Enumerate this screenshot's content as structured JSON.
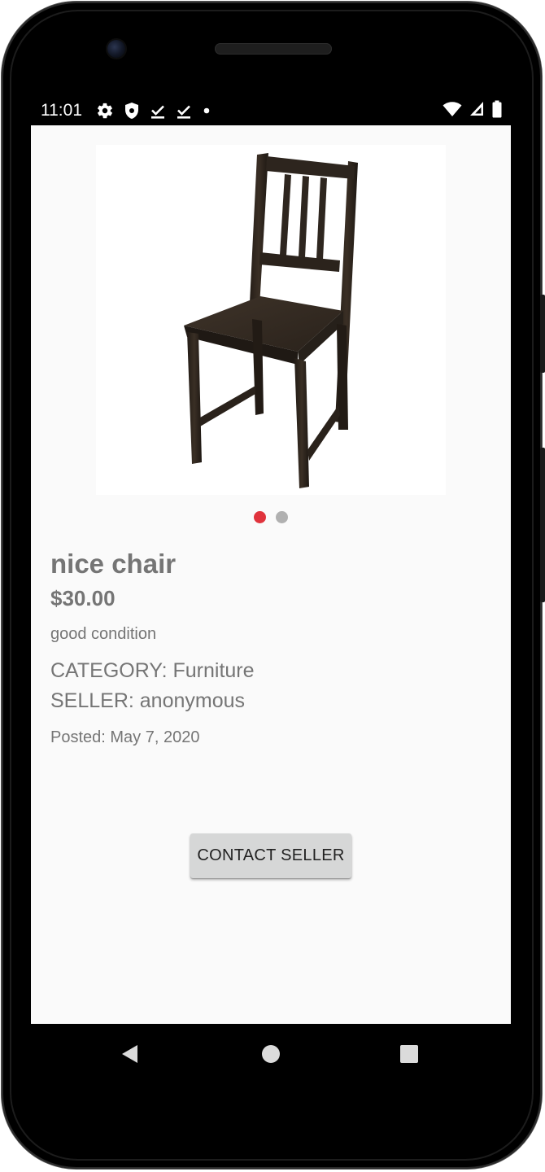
{
  "status_bar": {
    "time": "11:01",
    "left_icons": [
      "gear-icon",
      "shield-icon",
      "download-done-icon",
      "download-done-icon",
      "notification-dot-icon"
    ],
    "right_icons": [
      "wifi-icon",
      "cell-signal-icon",
      "battery-icon"
    ]
  },
  "product": {
    "image": "chair-photo",
    "carousel": {
      "count": 2,
      "active_index": 0,
      "active_color": "#e0333c",
      "inactive_color": "#b0b0b0"
    },
    "title": "nice chair",
    "price": "$30.00",
    "condition": "good condition",
    "category": "CATEGORY: Furniture",
    "seller": "SELLER: anonymous",
    "posted": "Posted: May 7, 2020"
  },
  "actions": {
    "contact_label": "CONTACT SELLER"
  },
  "nav_bar": {
    "items": [
      "back-icon",
      "home-icon",
      "recents-icon"
    ]
  },
  "colors": {
    "screen_background": "#fafafa",
    "text_secondary": "#757575",
    "button_background": "#d6d7d7"
  }
}
